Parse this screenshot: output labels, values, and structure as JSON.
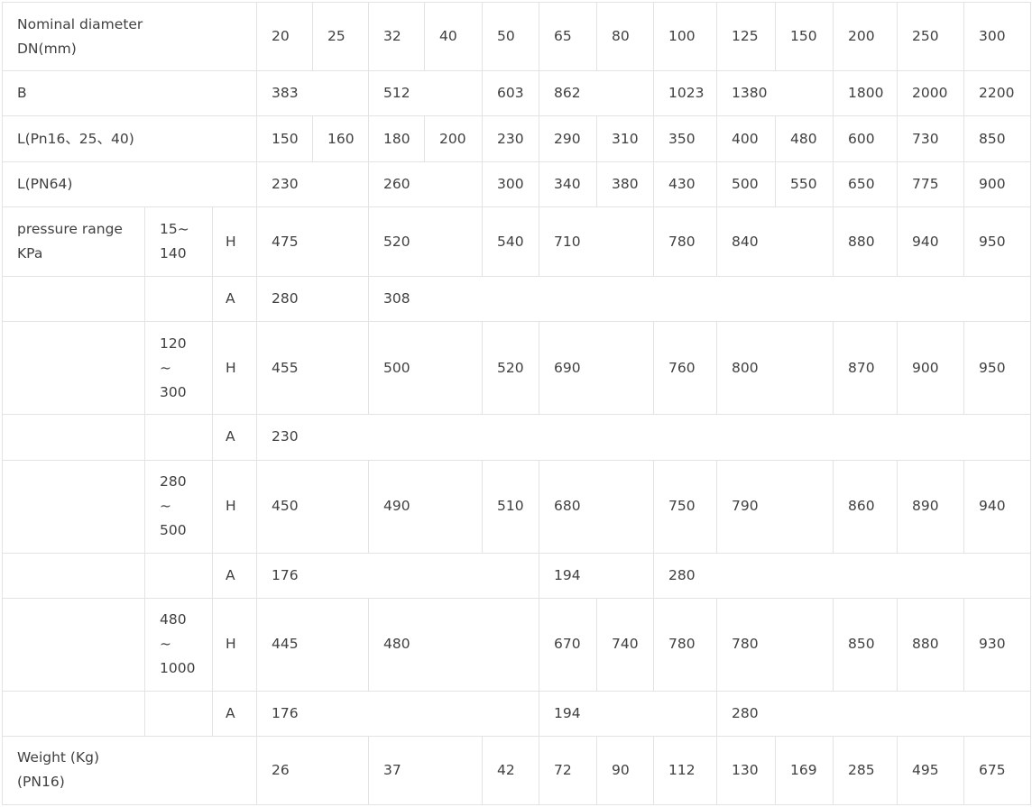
{
  "table": {
    "header_label_line1": "Nominal diameter",
    "header_label_line2": "DN(mm)",
    "dn": [
      "20",
      "25",
      "32",
      "40",
      "50",
      "65",
      "80",
      "100",
      "125",
      "150",
      "200",
      "250",
      "300"
    ],
    "b_label": "B",
    "b_values": [
      "383",
      "512",
      "603",
      "862",
      "1023",
      "1380",
      "1800",
      "2000",
      "2200"
    ],
    "l16_label": "L(Pn16、25、40)",
    "l16_values": [
      "150",
      "160",
      "180",
      "200",
      "230",
      "290",
      "310",
      "350",
      "400",
      "480",
      "600",
      "730",
      "850"
    ],
    "l64_label": "L(PN64)",
    "l64_values": [
      "230",
      "260",
      "300",
      "340",
      "380",
      "430",
      "500",
      "550",
      "650",
      "775",
      "900"
    ],
    "pressure_label_line1": "pressure range",
    "pressure_label_line2": "KPa",
    "h_label": "H",
    "a_label": "A",
    "r1": {
      "range_line1": "15~",
      "range_line2": "140",
      "h": [
        "475",
        "520",
        "540",
        "710",
        "780",
        "840",
        "880",
        "940",
        "950"
      ],
      "a": [
        "280",
        "308"
      ]
    },
    "r2": {
      "range_line1": "120",
      "range_line2": "~",
      "range_line3": "300",
      "h": [
        "455",
        "500",
        "520",
        "690",
        "760",
        "800",
        "870",
        "900",
        "950"
      ],
      "a": [
        "230"
      ]
    },
    "r3": {
      "range_line1": "280",
      "range_line2": "~",
      "range_line3": "500",
      "h": [
        "450",
        "490",
        "510",
        "680",
        "750",
        "790",
        "860",
        "890",
        "940"
      ],
      "a": [
        "176",
        "194",
        "280"
      ]
    },
    "r4": {
      "range_line1": "480",
      "range_line2": "~",
      "range_line3": "1000",
      "h": [
        "445",
        "480",
        "670",
        "740",
        "780",
        "780",
        "850",
        "880",
        "930"
      ],
      "a": [
        "176",
        "194",
        "280"
      ]
    },
    "weight_label_line1": "Weight (Kg)",
    "weight_label_line2": "(PN16)",
    "weight_values": [
      "26",
      "37",
      "42",
      "72",
      "90",
      "112",
      "130",
      "169",
      "285",
      "495",
      "675"
    ]
  }
}
